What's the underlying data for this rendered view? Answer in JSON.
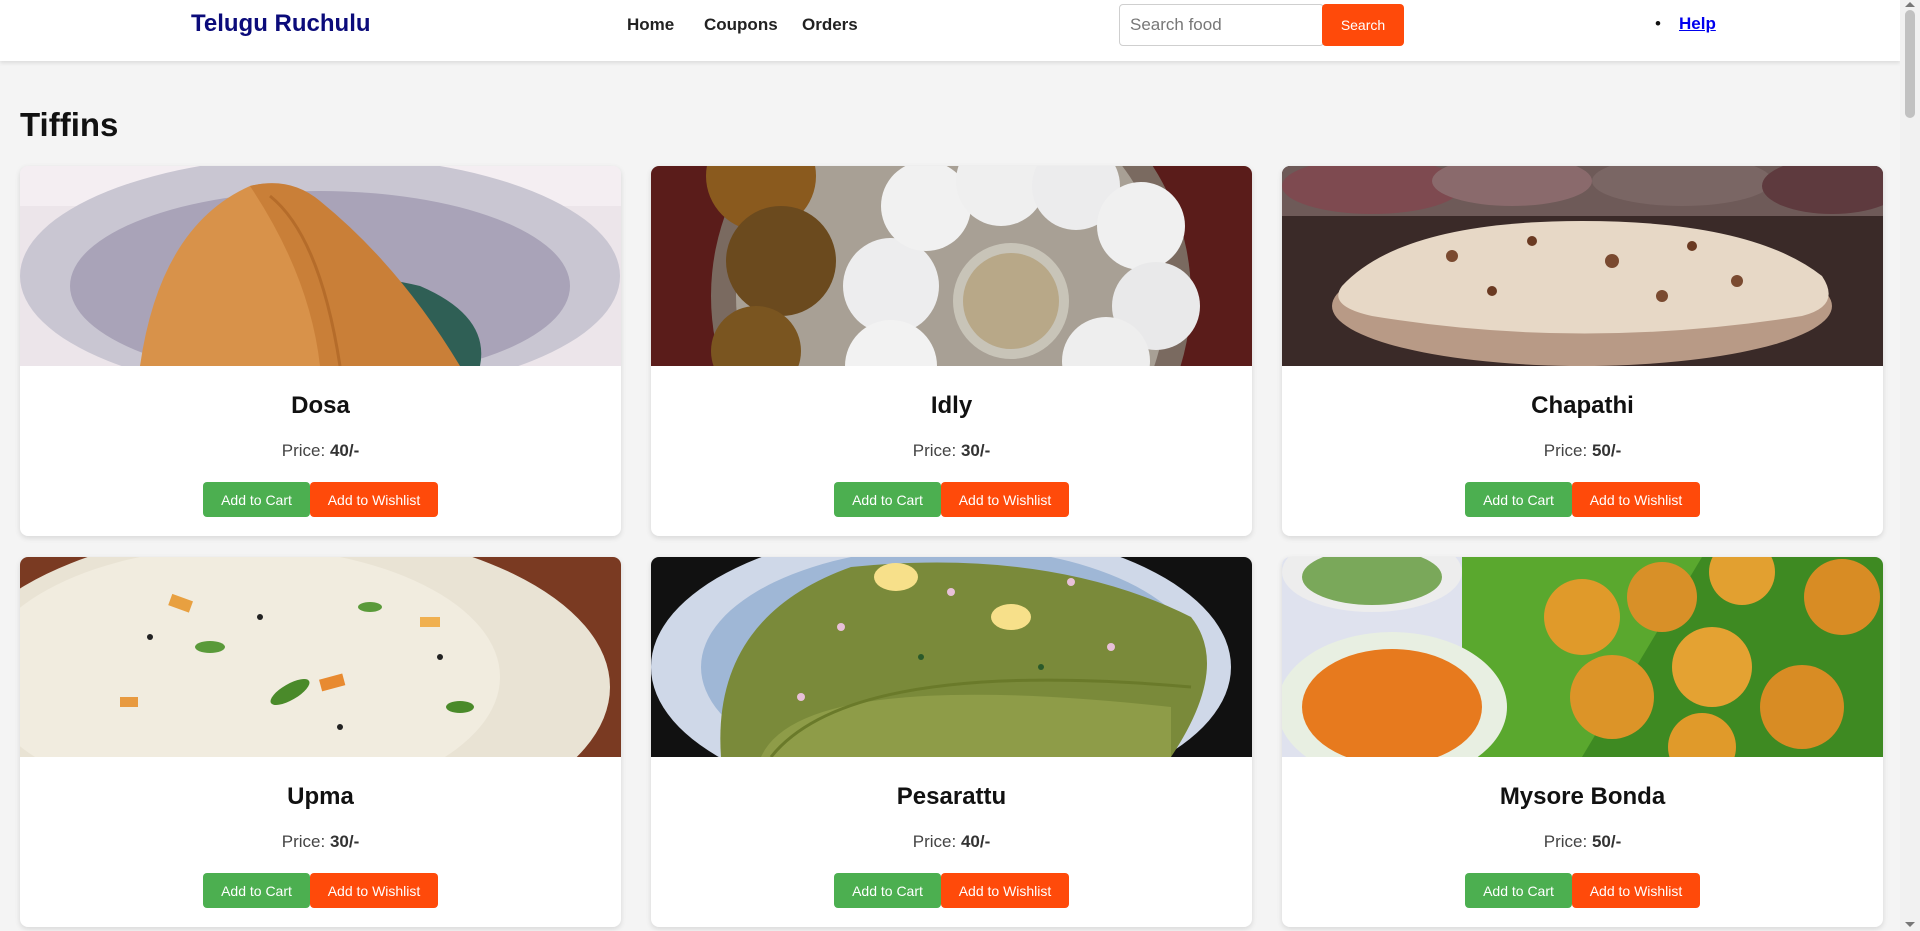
{
  "navbar": {
    "brand": "Telugu Ruchulu",
    "links": [
      "Home",
      "Coupons",
      "Orders"
    ],
    "search": {
      "placeholder": "Search food",
      "value": "",
      "button": "Search"
    },
    "help_bullet": "•",
    "help": "Help"
  },
  "section": {
    "title": "Tiffins"
  },
  "price_label": "Price: ",
  "buttons": {
    "cart": "Add to Cart",
    "wishlist": "Add to Wishlist"
  },
  "items": [
    {
      "name": "Dosa",
      "price": "40/-"
    },
    {
      "name": "Idly",
      "price": "30/-"
    },
    {
      "name": "Chapathi",
      "price": "50/-"
    },
    {
      "name": "Upma",
      "price": "30/-"
    },
    {
      "name": "Pesarattu",
      "price": "40/-"
    },
    {
      "name": "Mysore Bonda",
      "price": "50/-"
    }
  ],
  "colors": {
    "brand": "#0b0b7a",
    "accent": "#ff4a0a",
    "cart_button": "#4caf50",
    "link": "#0000ee",
    "page_bg": "#f4f4f4"
  }
}
